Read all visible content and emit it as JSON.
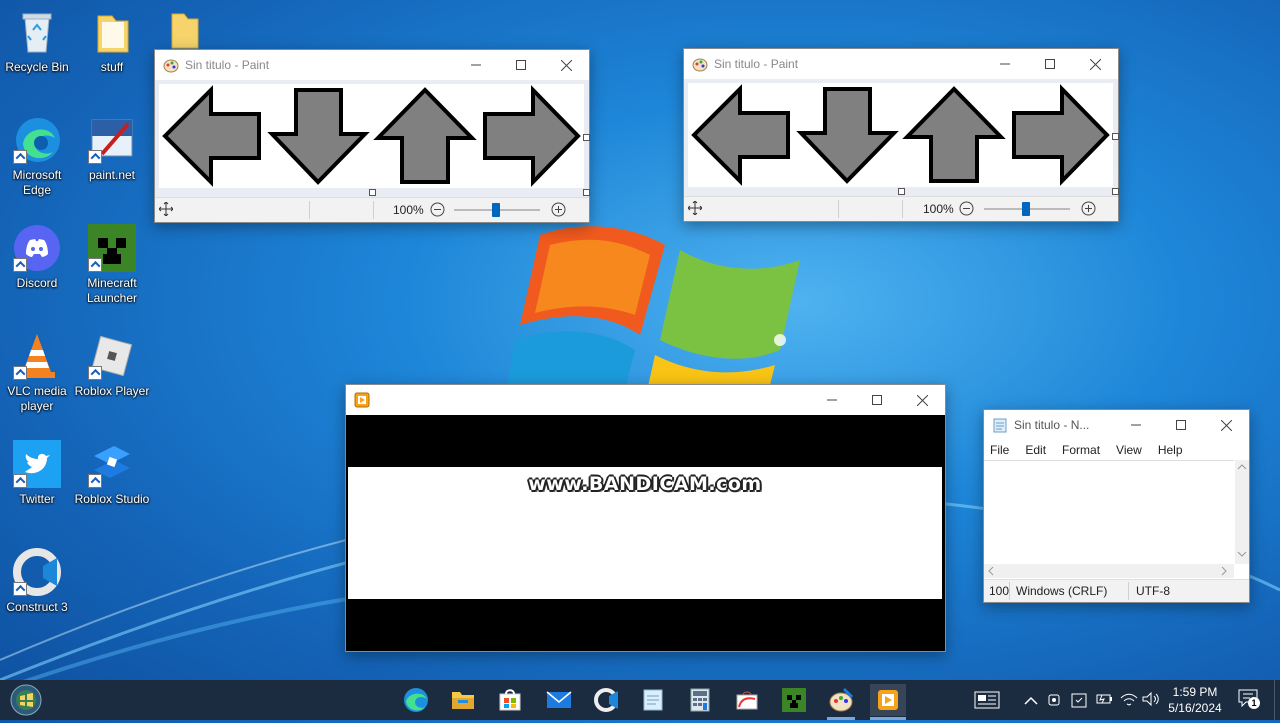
{
  "desktop": {
    "icons": [
      {
        "label": "Recycle Bin",
        "icon": "recycle-bin-icon"
      },
      {
        "label": "stuff",
        "icon": "folder-icon"
      },
      {
        "label": "",
        "icon": "folder-icon"
      },
      {
        "label": "Microsoft Edge",
        "icon": "edge-icon"
      },
      {
        "label": "paint.net",
        "icon": "paintnet-icon"
      },
      {
        "label": "Discord",
        "icon": "discord-icon"
      },
      {
        "label": "Minecraft Launcher",
        "icon": "minecraft-icon"
      },
      {
        "label": "VLC media player",
        "icon": "vlc-icon"
      },
      {
        "label": "Roblox Player",
        "icon": "roblox-icon"
      },
      {
        "label": "Twitter",
        "icon": "twitter-icon"
      },
      {
        "label": "Roblox Studio",
        "icon": "roblox-studio-icon"
      },
      {
        "label": "Construct 3",
        "icon": "construct-icon"
      }
    ]
  },
  "paint_left": {
    "title": "Sin titulo - Paint",
    "zoom": "100%",
    "zoom_fraction": 0.5
  },
  "paint_right": {
    "title": "Sin titulo - Paint",
    "zoom": "100%",
    "zoom_fraction": 0.5
  },
  "bandicam": {
    "title": "",
    "watermark": "www.BANDICAM.com"
  },
  "notepad": {
    "title": "Sin titulo - N...",
    "menu": [
      "File",
      "Edit",
      "Format",
      "View",
      "Help"
    ],
    "status_zoom": "100",
    "status_eol": "Windows (CRLF)",
    "status_encoding": "UTF-8"
  },
  "taskbar": {
    "apps": [
      "edge-icon",
      "file-explorer-icon",
      "store-icon",
      "mail-icon",
      "construct-icon",
      "notepad-icon",
      "calculator-icon",
      "paint-icon",
      "minecraft-icon",
      "paintnet-icon",
      "bandicam-icon"
    ],
    "time": "1:59 PM",
    "date": "5/16/2024",
    "notifications": "1"
  },
  "colors": {
    "arrow_fill": "#808080",
    "arrow_stroke": "#000000",
    "taskbar": "#1c2c40",
    "accent": "#0067c0"
  }
}
